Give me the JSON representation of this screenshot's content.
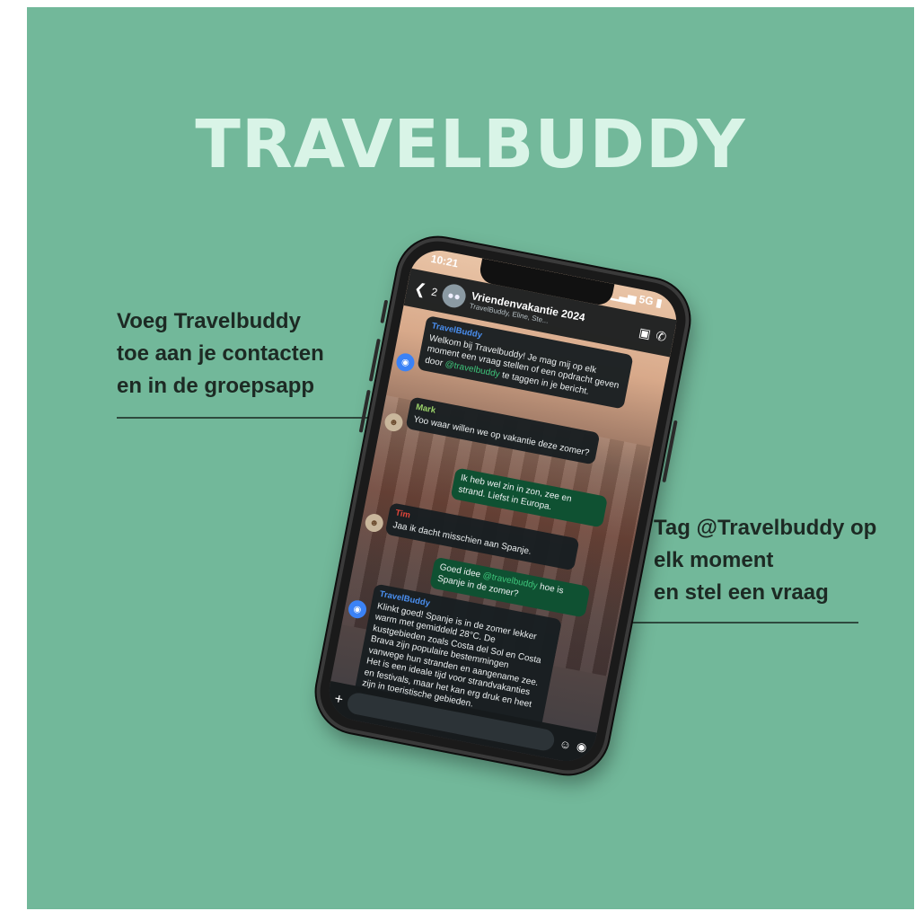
{
  "title": "TRAVELBUDDY",
  "callouts": {
    "left": [
      "Voeg Travelbuddy",
      "toe aan je contacten",
      "en in de groepsapp"
    ],
    "right": [
      "Tag @Travelbuddy op",
      "elk moment",
      "en stel een vraag"
    ]
  },
  "phone": {
    "status_time": "10:21",
    "status_signal": "▁▃▅ 5G ▮",
    "back_count": "2",
    "group_name": "Vriendenvakantie 2024",
    "group_members": "TravelBuddy, Eline, Ste...",
    "icons": [
      "back-arrow-icon",
      "group-avatar-icon",
      "video-call-icon",
      "phone-call-icon",
      "plus-icon",
      "sticker-icon",
      "camera-icon"
    ],
    "messages": [
      {
        "sender": "TravelBuddy",
        "text_before": "Welkom bij Travelbuddy! Je mag mij op elk moment een vraag stellen of een opdracht geven door ",
        "mention": "@travelbuddy",
        "text_after": " te taggen in je bericht."
      },
      {
        "sender": "Mark",
        "text": "Yoo waar willen we op vakantie deze zomer?"
      },
      {
        "text": "Ik heb wel zin in zon, zee en strand. Liefst in Europa."
      },
      {
        "sender": "Tim",
        "text": "Jaa ik dacht misschien aan Spanje."
      },
      {
        "text_before": "Goed idee ",
        "mention": "@travelbuddy",
        "text_after": " hoe is Spanje in de zomer?"
      },
      {
        "sender": "TravelBuddy",
        "text": "Klinkt goed! Spanje is in de zomer lekker warm met gemiddeld 28°C. De kustgebieden zoals Costa del Sol en Costa Brava zijn populaire bestemmingen vanwege hun stranden en aangename zee. Het is een ideale tijd voor strandvakanties en festivals, maar het kan erg druk en heet zijn in toeristische gebieden."
      }
    ]
  },
  "colors": {
    "background": "#72b89a",
    "title": "#d9f4e7",
    "callout_text": "#1d2a24",
    "bot_name": "#4a8ff0",
    "mark_name": "#9bd36a",
    "tim_name": "#e0453a",
    "mention": "#3ec47a",
    "outgoing_bubble": "#0f5132"
  }
}
